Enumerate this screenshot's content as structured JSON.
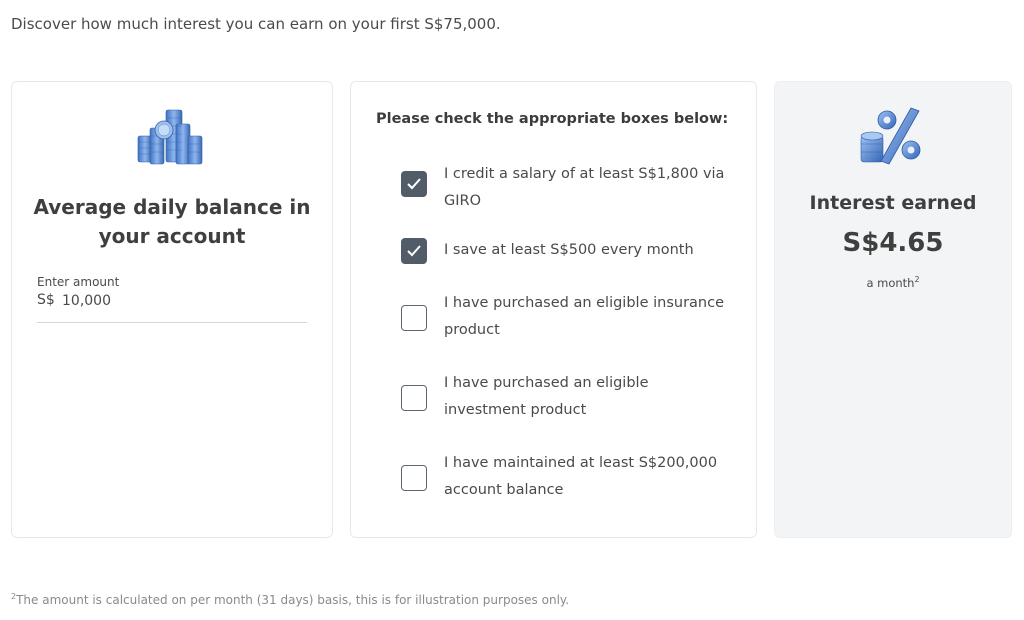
{
  "intro": "Discover how much interest you can earn on your first S$75,000.",
  "balance_card": {
    "icon": "coins-stack-icon",
    "title": "Average daily balance in your account",
    "input_label": "Enter amount",
    "currency": "S$",
    "amount": "10,000"
  },
  "checks_card": {
    "title": "Please check the appropriate boxes below:",
    "options": [
      {
        "label": "I credit a salary of at least S$1,800 via GIRO",
        "checked": true
      },
      {
        "label": "I save at least S$500 every month",
        "checked": true
      },
      {
        "label": "I have purchased an eligible insurance product",
        "checked": false
      },
      {
        "label": "I have purchased an eligible investment product",
        "checked": false
      },
      {
        "label": "I have maintained at least S$200,000 account balance",
        "checked": false
      }
    ]
  },
  "result_card": {
    "icon": "percent-coins-icon",
    "title": "Interest earned",
    "value": "S$4.65",
    "period": "a month",
    "period_note": "2"
  },
  "footnote": {
    "marker": "2",
    "text": "The amount is calculated on per month (31 days) basis, this is for illustration purposes only."
  },
  "colors": {
    "checkbox_checked": "#515c68",
    "result_background": "#f3f4f6",
    "icon_blue": "#5b8fd6"
  }
}
